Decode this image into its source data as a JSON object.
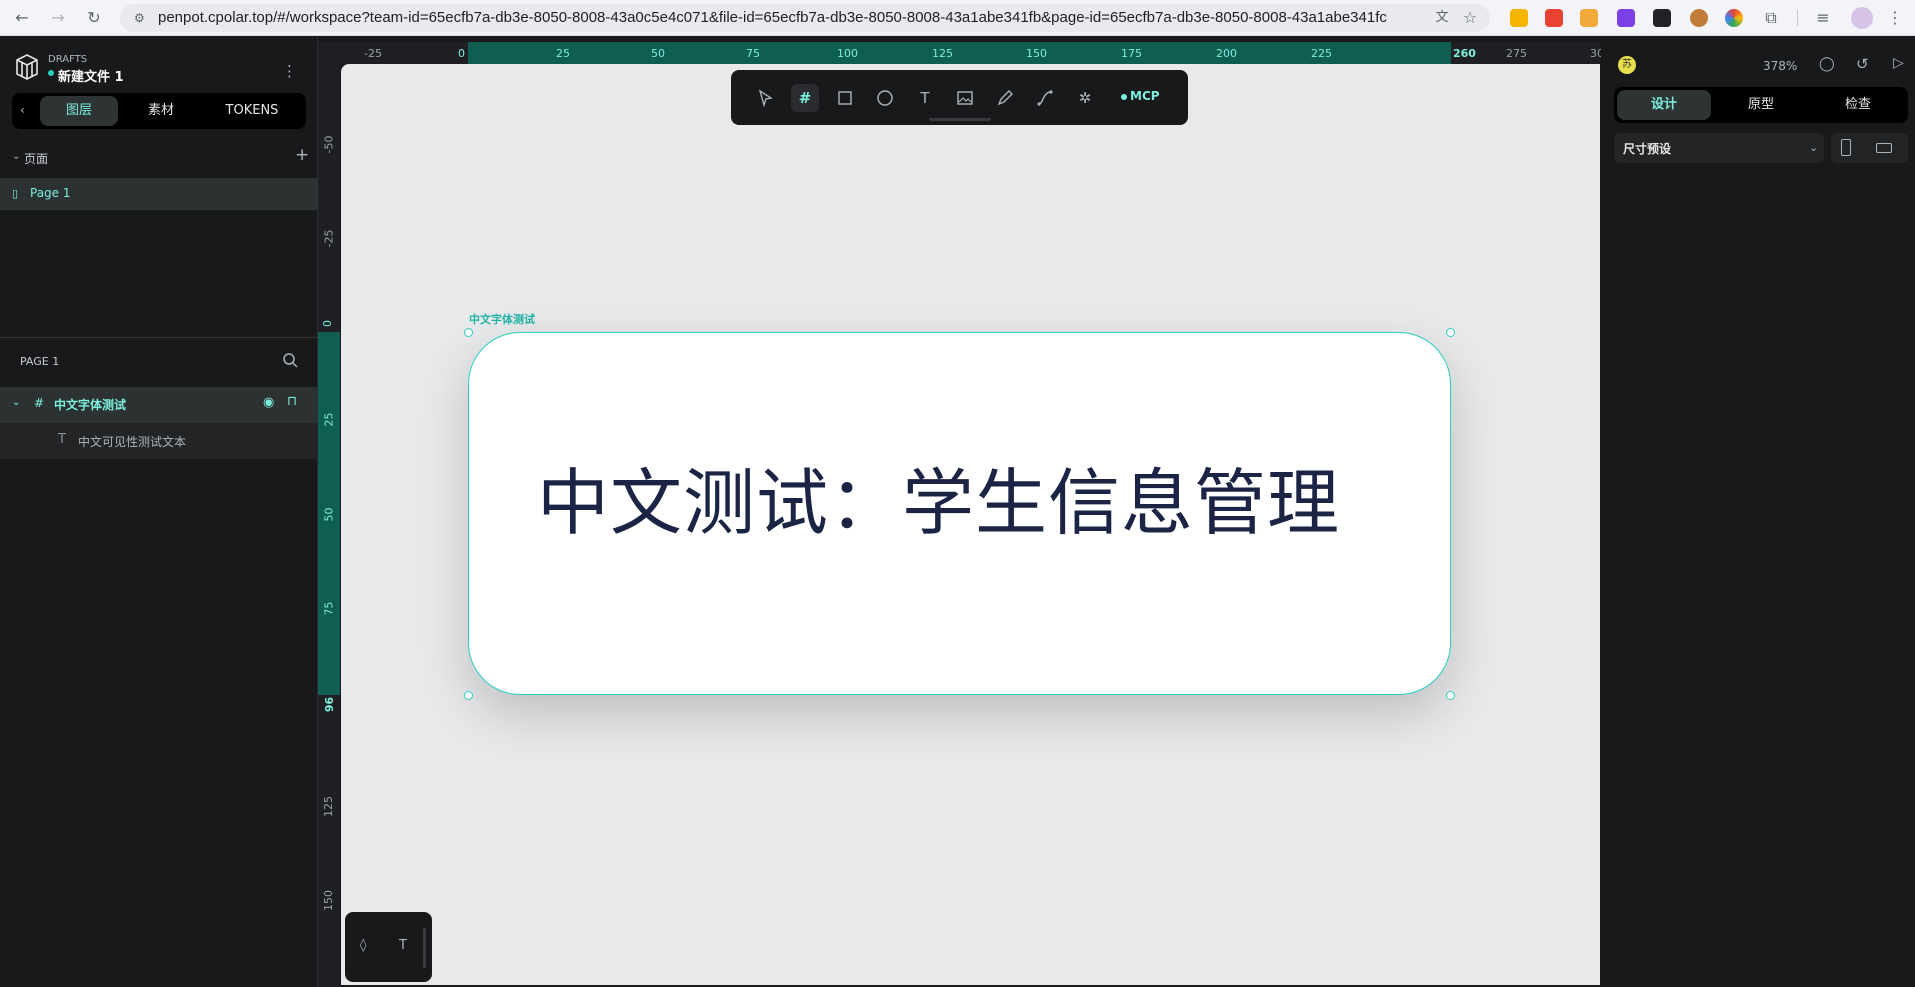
{
  "browser": {
    "url": "penpot.cpolar.top/#/workspace?team-id=65ecfb7a-db3e-8050-8008-43a0c5e4c071&file-id=65ecfb7a-db3e-8050-8008-43a1abe341fb&page-id=65ecfb7a-db3e-8050-8008-43a1abe341fc"
  },
  "header": {
    "project": "DRAFTS",
    "file_name": "新建文件 1"
  },
  "left_tabs": [
    "图层",
    "素材",
    "TOKENS"
  ],
  "pages": {
    "title": "页面",
    "items": [
      "Page 1"
    ]
  },
  "layers": {
    "title": "PAGE 1",
    "board_name": "中文字体测试",
    "text_layer": "中文可见性测试文本"
  },
  "hruler_ticks": [
    "-25",
    "0",
    "25",
    "50",
    "75",
    "100",
    "125",
    "150",
    "175",
    "200",
    "225",
    "260",
    "275",
    "30"
  ],
  "vruler_ticks": [
    "-50",
    "-25",
    "0",
    "25",
    "50",
    "75",
    "96",
    "125",
    "150"
  ],
  "canvas": {
    "board_label": "中文字体测试",
    "text": "中文测试：学生信息管理"
  },
  "toolbar": {
    "mcp_label": "MCP"
  },
  "right_panel": {
    "avatar_letter": "苏",
    "zoom": "378%",
    "tabs": [
      "设计",
      "原型",
      "检查"
    ],
    "size_preset": "尺寸预设"
  },
  "colors": {
    "accent": "#2bcfc2",
    "ruler_highlight": "#0e5e52",
    "canvas_bg": "#e8e9eb",
    "panel_bg": "#18191b",
    "text_dark": "#1b2444"
  }
}
